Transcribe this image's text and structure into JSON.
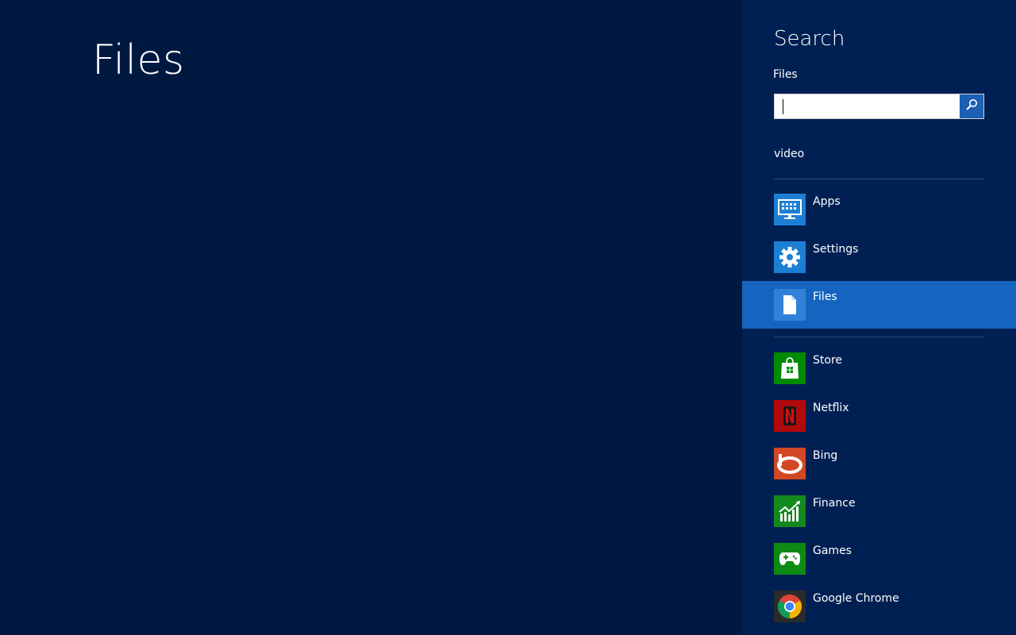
{
  "main": {
    "title": "Files"
  },
  "charm": {
    "title": "Search",
    "scope": "Files",
    "search": {
      "value": "",
      "placeholder": ""
    },
    "suggestion": "video",
    "scopes": [
      {
        "label": "Apps",
        "icon": "apps-icon",
        "color": "#1c7fd4"
      },
      {
        "label": "Settings",
        "icon": "gear-icon",
        "color": "#1c7fd4"
      },
      {
        "label": "Files",
        "icon": "file-icon",
        "color": "#2f82d8",
        "selected": true
      }
    ],
    "apps": [
      {
        "label": "Store",
        "icon": "store-icon",
        "color": "#008a00"
      },
      {
        "label": "Netflix",
        "icon": "netflix-icon",
        "color": "#b20a0a"
      },
      {
        "label": "Bing",
        "icon": "bing-icon",
        "color": "#d24726"
      },
      {
        "label": "Finance",
        "icon": "finance-icon",
        "color": "#128a1e"
      },
      {
        "label": "Games",
        "icon": "games-icon",
        "color": "#0c8a14"
      },
      {
        "label": "Google Chrome",
        "icon": "chrome-icon",
        "color": "#2b2b2b"
      }
    ]
  }
}
